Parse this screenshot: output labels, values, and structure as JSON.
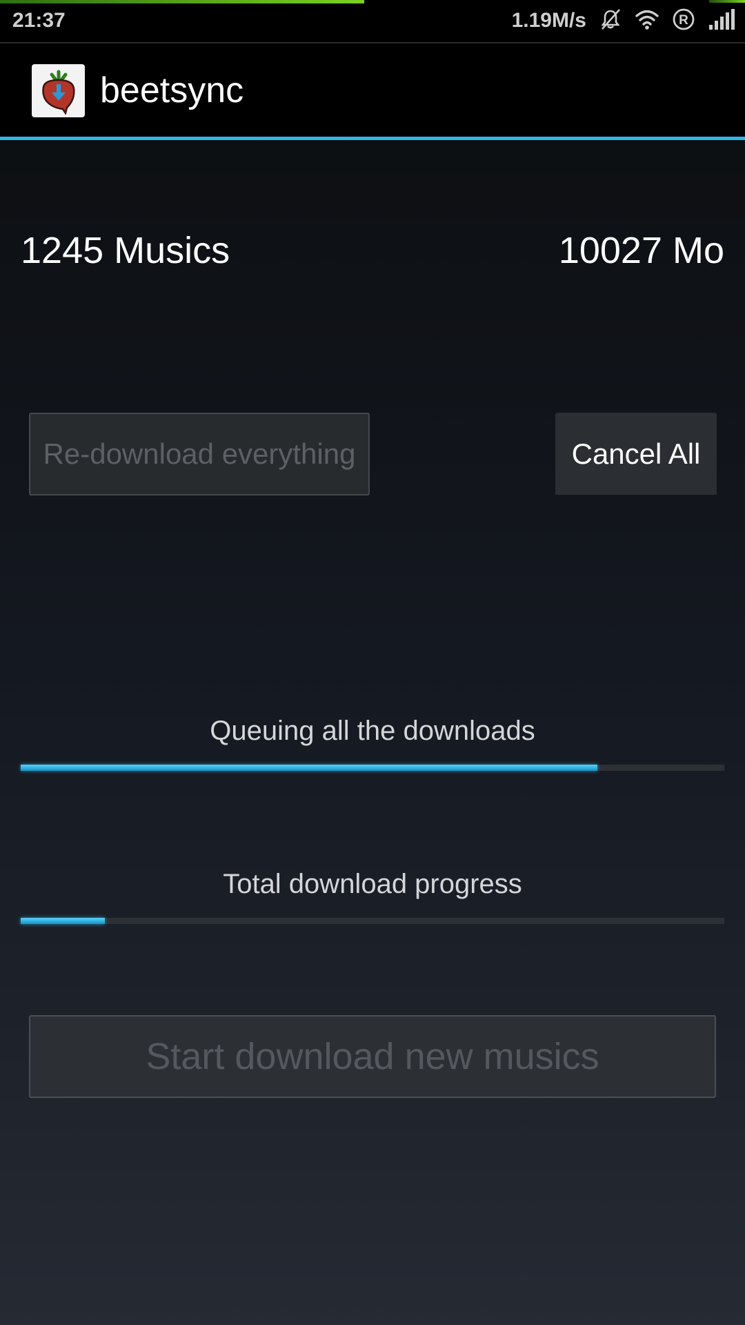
{
  "status_bar": {
    "time": "21:37",
    "network_speed": "1.19M/s",
    "icons": [
      "vibrate-silent-icon",
      "wifi-icon",
      "registered-icon",
      "cell-signal-icon"
    ]
  },
  "app": {
    "title": "beetsync",
    "accent_color": "#33b5e5"
  },
  "stats": {
    "music_count": "1245 Musics",
    "total_size": "10027 Mo"
  },
  "buttons": {
    "redownload_label": "Re-download everything",
    "redownload_enabled": false,
    "cancel_label": "Cancel All",
    "cancel_enabled": true,
    "start_label": "Start download new musics",
    "start_enabled": false
  },
  "progress": {
    "queue_label": "Queuing all the downloads",
    "queue_fraction": 0.82,
    "total_label": "Total download progress",
    "total_fraction": 0.12
  }
}
